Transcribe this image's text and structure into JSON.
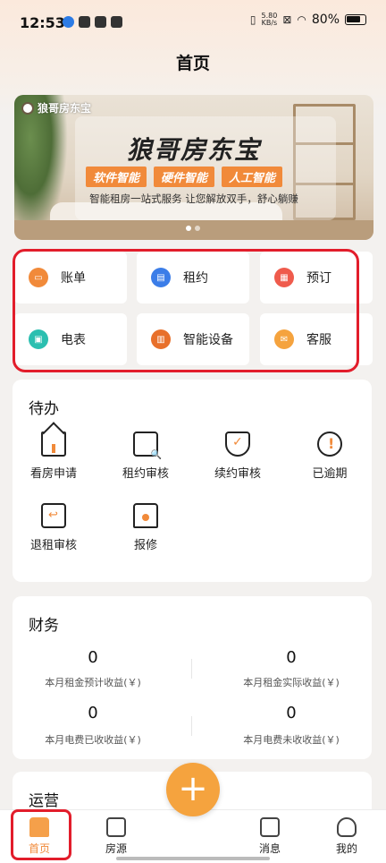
{
  "status_bar": {
    "time": "12:53",
    "speed_top": "5.80",
    "speed_unit": "KB/s",
    "battery": "80%"
  },
  "page_title": "首页",
  "banner": {
    "brand": "狼哥房东宝",
    "title": "狼哥房东宝",
    "tags": [
      "软件智能",
      "硬件智能",
      "人工智能"
    ],
    "subtitle": "智能租房一站式服务 让您解放双手，舒心躺赚"
  },
  "quick_actions": [
    {
      "label": "账单",
      "icon": "wallet-icon",
      "color": "#f18a3a"
    },
    {
      "label": "租约",
      "icon": "contract-icon",
      "color": "#3b7de8"
    },
    {
      "label": "预订",
      "icon": "calendar-icon",
      "color": "#ef5b4c"
    },
    {
      "label": "电表",
      "icon": "meter-icon",
      "color": "#2bbfb0"
    },
    {
      "label": "智能设备",
      "icon": "device-icon",
      "color": "#e8702b"
    },
    {
      "label": "客服",
      "icon": "service-icon",
      "color": "#f5a33e"
    }
  ],
  "todo": {
    "title": "待办",
    "items": [
      "看房申请",
      "租约审核",
      "续约审核",
      "已逾期",
      "退租审核",
      "报修"
    ]
  },
  "finance": {
    "title": "财务",
    "items": [
      {
        "value": "0",
        "label": "本月租金预计收益(￥)"
      },
      {
        "value": "0",
        "label": "本月租金实际收益(￥)"
      },
      {
        "value": "0",
        "label": "本月电费已收收益(￥)"
      },
      {
        "value": "0",
        "label": "本月电费未收收益(￥)"
      }
    ]
  },
  "operations": {
    "title": "运营"
  },
  "tabbar": {
    "home": "首页",
    "rooms": "房源",
    "add": "+",
    "messages": "消息",
    "mine": "我的"
  },
  "colors": {
    "accent": "#f5a33e",
    "highlight": "#e21d2b"
  }
}
